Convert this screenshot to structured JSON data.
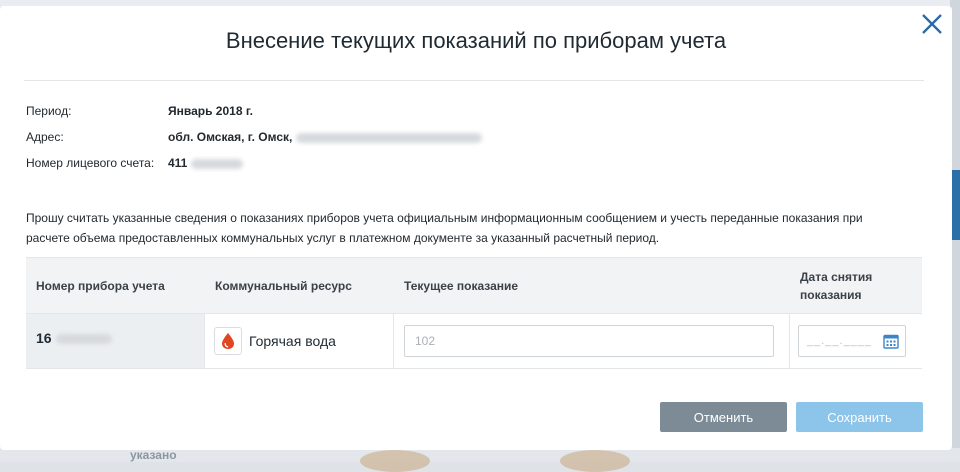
{
  "dialog": {
    "title": "Внесение текущих показаний по приборам учета"
  },
  "info": {
    "period_label": "Период:",
    "period_value": "Январь 2018 г.",
    "address_label": "Адрес:",
    "address_value": "обл. Омская, г. Омск,",
    "account_label": "Номер лицевого счета:",
    "account_value": "411"
  },
  "notice": "Прошу считать указанные сведения о показаниях приборов учета официальным информационным сообщением и учесть переданные показания при расчете объема предоставленных коммунальных услуг в платежном документе за указанный расчетный период.",
  "table": {
    "headers": {
      "meter_number": "Номер прибора учета",
      "resource": "Коммунальный ресурс",
      "current_reading": "Текущее показание",
      "reading_date": "Дата снятия показания"
    },
    "rows": [
      {
        "meter_number": "16",
        "resource": "Горячая вода",
        "resource_icon": "water-drop-icon",
        "resource_color": "#e0461f",
        "reading_placeholder": "102",
        "date_mask": "__.__.____"
      }
    ]
  },
  "buttons": {
    "cancel": "Отменить",
    "save": "Сохранить"
  },
  "background": {
    "bottom_text": "указано"
  },
  "colors": {
    "close_icon": "#2b6ca6",
    "calendar_icon": "#3a86c8",
    "cancel_button": "#7d8b97",
    "save_button": "#8cc4ea"
  }
}
